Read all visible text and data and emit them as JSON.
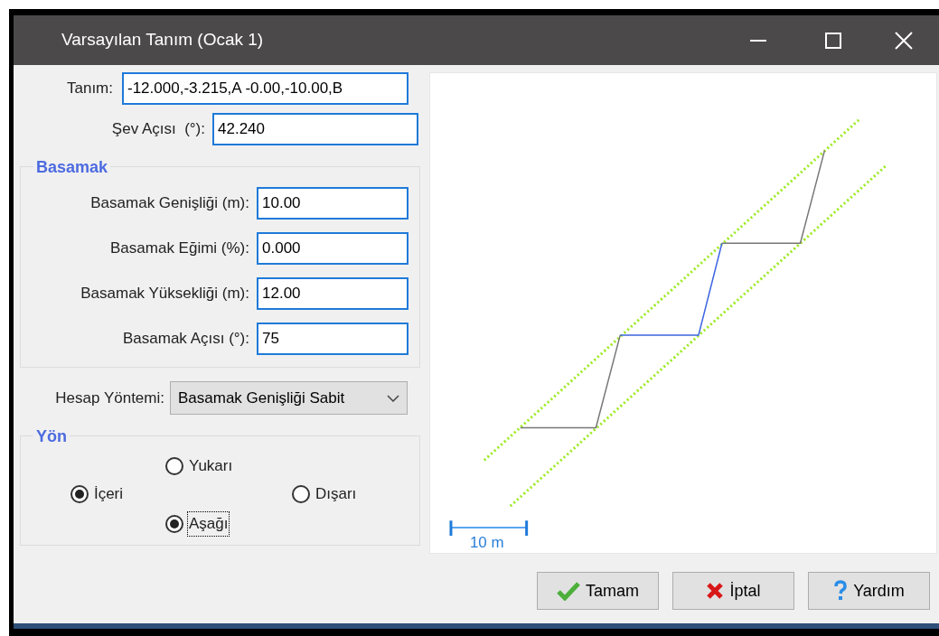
{
  "window": {
    "title": "Varsayılan Tanım (Ocak 1)"
  },
  "definition": {
    "label": "Tanım:",
    "value": "-12.000,-3.215,A -0.00,-10.00,B"
  },
  "slope_angle": {
    "label": "Şev Açısı  (°):",
    "value": "42.240"
  },
  "step_group": {
    "title": "Basamak",
    "fields": [
      {
        "label": "Basamak Genişliği (m):",
        "value": "10.00"
      },
      {
        "label": "Basamak Eğimi (%):",
        "value": "0.000"
      },
      {
        "label": "Basamak Yüksekliği (m):",
        "value": "12.00"
      },
      {
        "label": "Basamak Açısı (°):",
        "value": "75"
      }
    ]
  },
  "method": {
    "label": "Hesap Yöntemi:",
    "value": "Basamak Genişliği Sabit"
  },
  "direction_group": {
    "title": "Yön",
    "options": [
      {
        "label": "Yukarı",
        "kind": "top",
        "selected": false,
        "focused": false
      },
      {
        "label": "İçeri",
        "kind": "left",
        "selected": true,
        "focused": false
      },
      {
        "label": "Dışarı",
        "kind": "right",
        "selected": false,
        "focused": false
      },
      {
        "label": "Aşağı",
        "kind": "bottom",
        "selected": true,
        "focused": true
      }
    ]
  },
  "preview": {
    "scale_label": "10 m"
  },
  "buttons": [
    {
      "label": "Tamam",
      "kind": "ok"
    },
    {
      "label": "İptal",
      "kind": "cancel"
    },
    {
      "label": "Yardım",
      "kind": "help"
    }
  ]
}
